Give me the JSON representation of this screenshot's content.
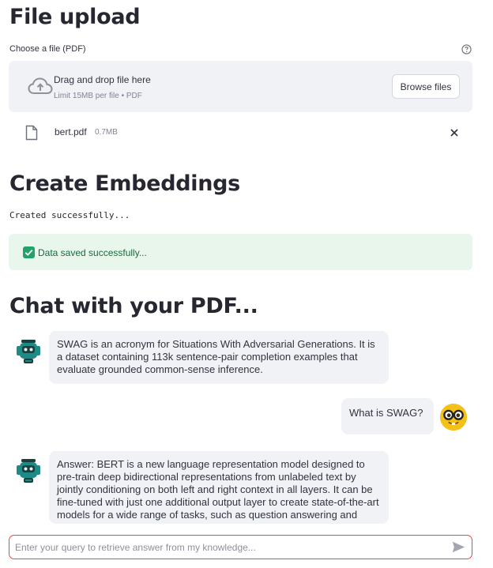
{
  "sections": {
    "upload_title": "File upload",
    "embed_title": "Create Embeddings",
    "chat_title": "Chat with your PDF..."
  },
  "uploader": {
    "label": "Choose a file (PDF)",
    "help_icon": "question-circle-icon",
    "dropzone_icon": "cloud-upload-icon",
    "drag_text": "Drag and drop file here",
    "limit_text": "Limit 15MB per file • PDF",
    "browse_label": "Browse files"
  },
  "uploaded_file": {
    "icon": "file-icon",
    "name": "bert.pdf",
    "size": "0.7MB",
    "remove_icon": "close-icon"
  },
  "embeddings": {
    "status_code": "Created successfully...",
    "success_icon": "check-box-icon",
    "success_message": "Data saved successfully..."
  },
  "chat": {
    "messages": [
      {
        "role": "assistant",
        "avatar": "robot-avatar-icon",
        "text": "SWAG is an acronym for Situations With Adversarial Generations. It is a dataset containing 113k sentence-pair completion examples that evaluate grounded common-sense inference."
      },
      {
        "role": "user",
        "avatar": "nerd-face-avatar-icon",
        "text": "What is SWAG?"
      },
      {
        "role": "assistant",
        "avatar": "robot-avatar-icon",
        "text": "Answer: BERT is a new language representation model designed to pre-train deep bidirectional representations from unlabeled text by jointly conditioning on both left and right context in all layers. It can be fine-tuned with just one additional output layer to create state-of-the-art models for a wide range of tasks, such as question answering and"
      }
    ],
    "input_placeholder": "Enter your query to retrieve answer from my knowledge...",
    "input_value": "",
    "send_icon": "send-icon"
  },
  "colors": {
    "dropzone_bg": "#f0f2f6",
    "success_bg": "#e8f6ec",
    "success_check": "#20a36a",
    "input_border_focus": "#e3484c",
    "bot_avatar": "#1d8a86",
    "user_avatar": "#f2c21b"
  }
}
